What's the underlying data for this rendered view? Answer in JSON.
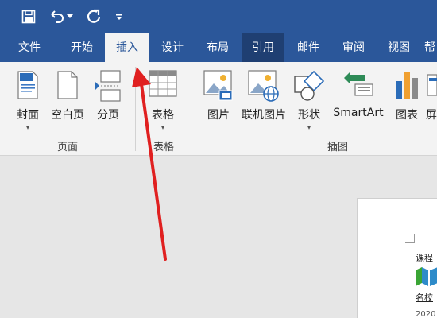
{
  "quick_access": {
    "save_icon": "save-icon",
    "undo_icon": "undo-icon",
    "undo_dropdown_icon": "chevron-down-icon",
    "redo_icon": "redo-icon",
    "customize_icon": "customize-qat-icon"
  },
  "tabs": [
    {
      "label": "文件"
    },
    {
      "label": "开始"
    },
    {
      "label": "插入"
    },
    {
      "label": "设计"
    },
    {
      "label": "布局"
    },
    {
      "label": "引用"
    },
    {
      "label": "邮件"
    },
    {
      "label": "审阅"
    },
    {
      "label": "视图"
    },
    {
      "label": "帮"
    }
  ],
  "active_tab": "插入",
  "ribbon": {
    "pages": {
      "label": "页面",
      "commands": [
        {
          "label": "封面",
          "icon": "cover-page-icon",
          "dropdown": "▾"
        },
        {
          "label": "空白页",
          "icon": "blank-page-icon"
        },
        {
          "label": "分页",
          "icon": "page-break-icon"
        }
      ]
    },
    "tables": {
      "label": "表格",
      "commands": [
        {
          "label": "表格",
          "icon": "table-icon",
          "dropdown": "▾"
        }
      ]
    },
    "illustrations": {
      "label": "插图",
      "commands": [
        {
          "label": "图片",
          "icon": "picture-icon"
        },
        {
          "label": "联机图片",
          "icon": "online-picture-icon"
        },
        {
          "label": "形状",
          "icon": "shapes-icon",
          "dropdown": "▾"
        },
        {
          "label": "SmartArt",
          "icon": "smartart-icon"
        },
        {
          "label": "图表",
          "icon": "chart-icon"
        },
        {
          "label": "屏",
          "icon": "screenshot-icon"
        }
      ]
    }
  },
  "document": {
    "lines": [
      "课程",
      "名校",
      "2020"
    ]
  },
  "colors": {
    "accent": "#2b579a",
    "active_dark": "#1f3f72",
    "arrow": "#e02020"
  }
}
